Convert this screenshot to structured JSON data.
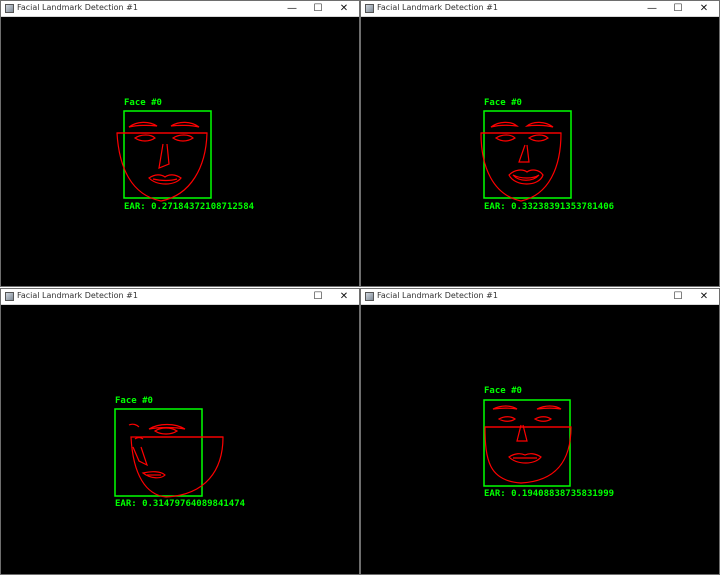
{
  "colors": {
    "detection_box": "#00ff00",
    "landmarks": "#ff0000",
    "background": "#000000"
  },
  "windows": [
    {
      "title": "Facial Landmark Detection #1",
      "controls": {
        "minimize": "—",
        "maximize": "☐",
        "close": "✕"
      },
      "face_label": "Face #0",
      "ear_label": "EAR: 0.27184372108712584"
    },
    {
      "title": "Facial Landmark Detection #1",
      "controls": {
        "minimize": "—",
        "maximize": "☐",
        "close": "✕"
      },
      "face_label": "Face #0",
      "ear_label": "EAR: 0.33238391353781406"
    },
    {
      "title": "Facial Landmark Detection #1",
      "controls": {
        "minimize": "",
        "maximize": "☐",
        "close": "✕"
      },
      "face_label": "Face #0",
      "ear_label": "EAR: 0.31479764089841474"
    },
    {
      "title": "Facial Landmark Detection #1",
      "controls": {
        "minimize": "",
        "maximize": "☐",
        "close": "✕"
      },
      "face_label": "Face #0",
      "ear_label": "EAR: 0.19408838735831999"
    }
  ]
}
